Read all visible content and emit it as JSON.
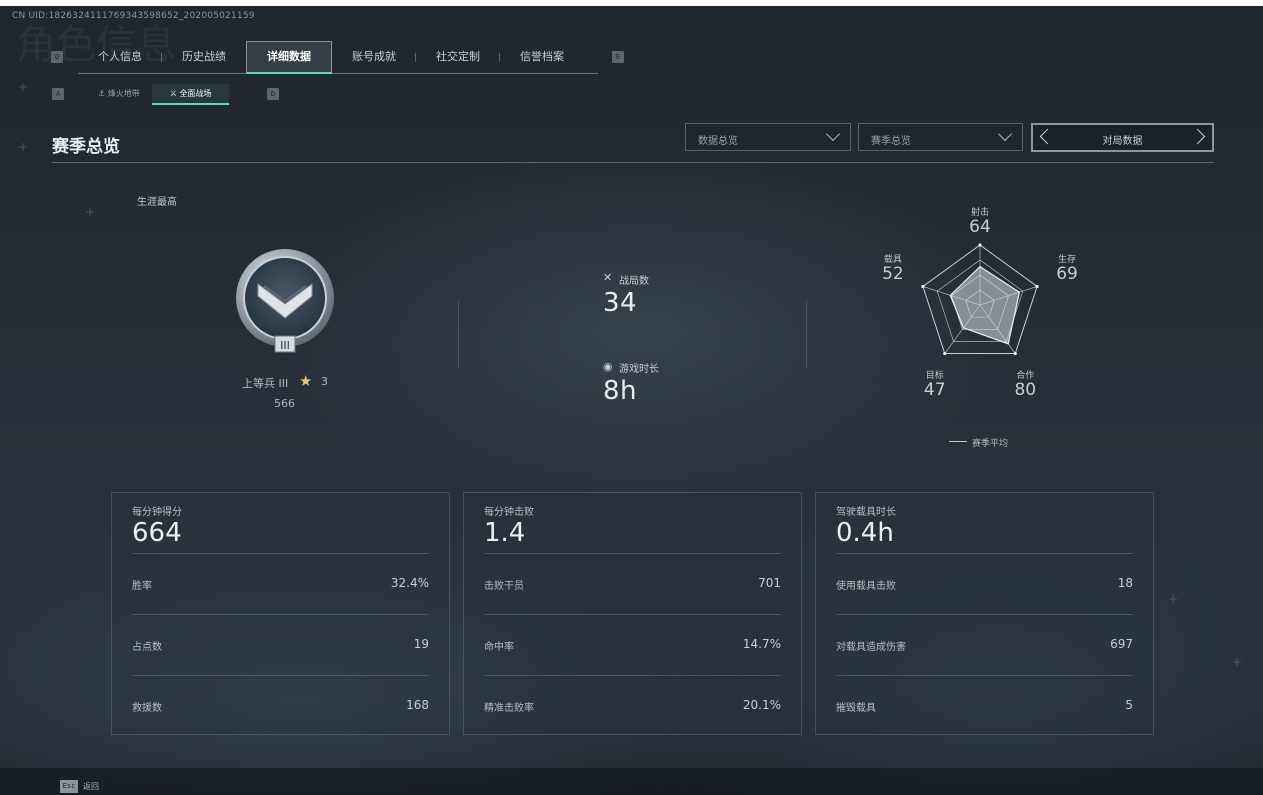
{
  "uid": "CN UID:1826324111769343598652_202005021159",
  "ghost_title": "角色信息",
  "keys": {
    "tab_prev": "Q",
    "tab_next": "E",
    "sub_prev": "A",
    "sub_next": "D",
    "esc": "Esc"
  },
  "tabs": [
    "个人信息",
    "历史战绩",
    "详细数据",
    "账号成就",
    "社交定制",
    "信誉档案"
  ],
  "active_tab": 2,
  "subtabs": [
    "烽火地带",
    "全面战场"
  ],
  "active_subtab": 1,
  "section_title": "赛季总览",
  "dropdowns": {
    "data": "数据总览",
    "season": "赛季总览"
  },
  "switcher": "对局数据",
  "career_label": "生涯最高",
  "rank": {
    "name": "上等兵 III",
    "stars": "3",
    "score": "566",
    "badge_numeral": "III"
  },
  "stats": {
    "matches_label": "战局数",
    "matches_value": "34",
    "playtime_label": "游戏时长",
    "playtime_value": "8h"
  },
  "radar": {
    "axes": [
      {
        "label": "射击",
        "value": 64
      },
      {
        "label": "生存",
        "value": 69
      },
      {
        "label": "合作",
        "value": 80
      },
      {
        "label": "目标",
        "value": 47
      },
      {
        "label": "载具",
        "value": 52
      }
    ],
    "legend": "赛季平均",
    "max": 100
  },
  "cards": [
    {
      "head_label": "每分钟得分",
      "head_value": "664",
      "rows": [
        {
          "label": "胜率",
          "value": "32.4%"
        },
        {
          "label": "占点数",
          "value": "19"
        },
        {
          "label": "救援数",
          "value": "168"
        }
      ]
    },
    {
      "head_label": "每分钟击败",
      "head_value": "1.4",
      "rows": [
        {
          "label": "击败干员",
          "value": "701"
        },
        {
          "label": "命中率",
          "value": "14.7%"
        },
        {
          "label": "精准击败率",
          "value": "20.1%"
        }
      ]
    },
    {
      "head_label": "驾驶载具时长",
      "head_value": "0.4h",
      "rows": [
        {
          "label": "使用载具击败",
          "value": "18"
        },
        {
          "label": "对载具造成伤害",
          "value": "697"
        },
        {
          "label": "摧毁载具",
          "value": "5"
        }
      ]
    }
  ],
  "footer": {
    "back_label": "返回"
  },
  "colors": {
    "accent": "#4de3b5",
    "star": "#e7c46a"
  }
}
